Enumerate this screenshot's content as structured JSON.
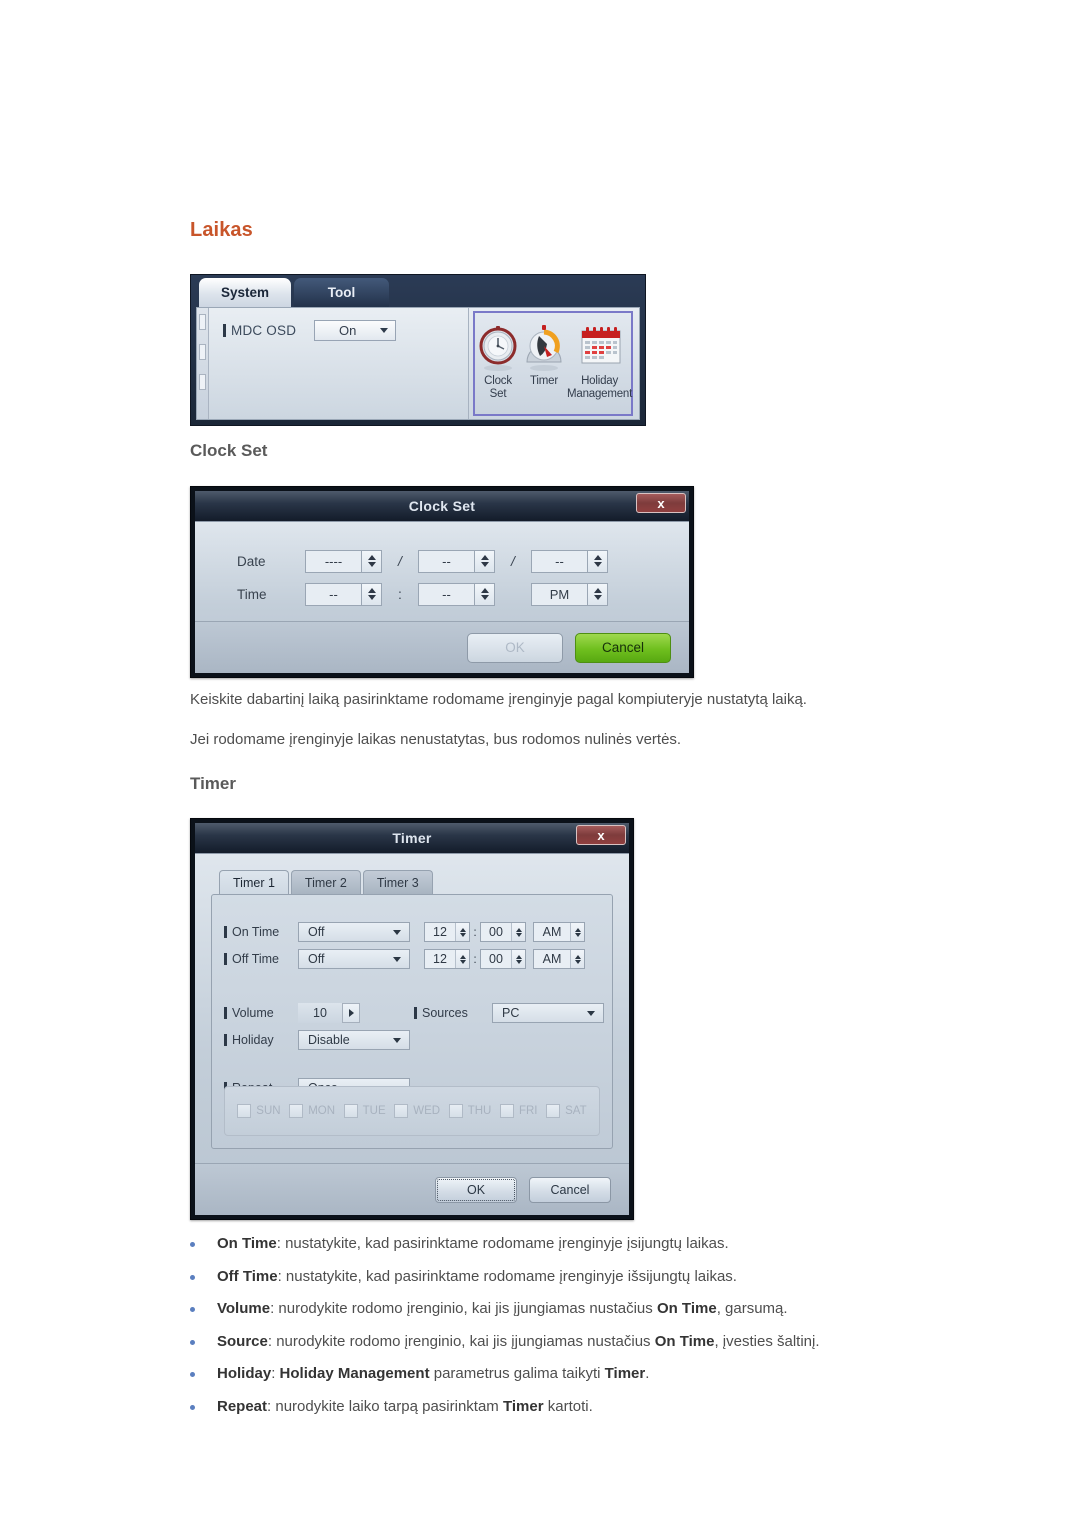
{
  "page": {
    "heading": "Laikas",
    "heading_color": "#c8552a",
    "subheading_clock": "Clock Set",
    "subheading_timer": "Timer"
  },
  "mdc_panel": {
    "tabs": [
      {
        "label": "System",
        "active": true
      },
      {
        "label": "Tool",
        "active": false
      }
    ],
    "setting_row": {
      "label": "MDC OSD",
      "value": "On"
    },
    "icons": [
      {
        "name": "clock-set-icon",
        "caption": "Clock\nSet"
      },
      {
        "name": "timer-icon",
        "caption": "Timer"
      },
      {
        "name": "holiday-management-icon",
        "caption": "Holiday\nManagement"
      }
    ],
    "selection_border_color": "#7a79c8"
  },
  "clock_set_dialog": {
    "title": "Clock Set",
    "close_label": "x",
    "rows": [
      {
        "label": "Date",
        "fields": [
          {
            "value": "----"
          },
          {
            "value": "--"
          },
          {
            "value": "--"
          }
        ],
        "separators": [
          "/",
          "/"
        ]
      },
      {
        "label": "Time",
        "fields": [
          {
            "value": "--"
          },
          {
            "value": "--"
          },
          {
            "value": "PM"
          }
        ],
        "separators": [
          ":",
          ""
        ]
      }
    ],
    "buttons": {
      "ok": "OK",
      "cancel": "Cancel",
      "ok_disabled": true,
      "cancel_color": "#6fbf1e"
    }
  },
  "timer_dialog": {
    "title": "Timer",
    "close_label": "x",
    "tabs": [
      {
        "label": "Timer 1",
        "active": true
      },
      {
        "label": "Timer 2",
        "active": false
      },
      {
        "label": "Timer 3",
        "active": false
      }
    ],
    "on_time": {
      "label": "On Time",
      "mode": "Off",
      "hour": "12",
      "minute": "00",
      "meridiem": "AM"
    },
    "off_time": {
      "label": "Off Time",
      "mode": "Off",
      "hour": "12",
      "minute": "00",
      "meridiem": "AM"
    },
    "volume": {
      "label": "Volume",
      "value": "10"
    },
    "sources": {
      "label": "Sources",
      "value": "PC"
    },
    "holiday": {
      "label": "Holiday",
      "value": "Disable"
    },
    "repeat": {
      "label": "Repeat",
      "value": "Once"
    },
    "days": [
      {
        "label": "SUN",
        "checked": false
      },
      {
        "label": "MON",
        "checked": false
      },
      {
        "label": "TUE",
        "checked": false
      },
      {
        "label": "WED",
        "checked": false
      },
      {
        "label": "THU",
        "checked": false
      },
      {
        "label": "FRI",
        "checked": false
      },
      {
        "label": "SAT",
        "checked": false
      }
    ],
    "buttons": {
      "ok": "OK",
      "cancel": "Cancel"
    }
  },
  "body_text": {
    "paragraph_1": "Keiskite dabartinį laiką pasirinktame rodomame įrenginyje pagal kompiuteryje nustatytą laiką.",
    "paragraph_2": "Jei rodomame įrenginyje laikas nenustatytas, bus rodomos nulinės vertės."
  },
  "bullets": [
    {
      "term": "On Time",
      "rest": ": nustatykite, kad pasirinktame rodomame įrenginyje įsijungtų laikas."
    },
    {
      "term": "Off Time",
      "rest": ": nustatykite, kad pasirinktame rodomame įrenginyje išsijungtų laikas."
    },
    {
      "term": "Volume",
      "rest": ": nurodykite rodomo įrenginio, kai jis įjungiamas nustačius ",
      "term2": "On Time",
      "rest2": ", garsumą."
    },
    {
      "term": "Source",
      "rest": ": nurodykite rodomo įrenginio, kai jis įjungiamas nustačius ",
      "term2": "On Time",
      "rest2": ", įvesties šaltinį."
    },
    {
      "term": "Holiday",
      "rest": ": ",
      "term2": "Holiday Management",
      "rest2": " parametrus galima taikyti ",
      "term3": "Timer",
      "rest3": "."
    },
    {
      "term": "Repeat",
      "rest": ": nurodykite laiko tarpą pasirinktam ",
      "term2": "Timer",
      "rest2": " kartoti."
    }
  ]
}
